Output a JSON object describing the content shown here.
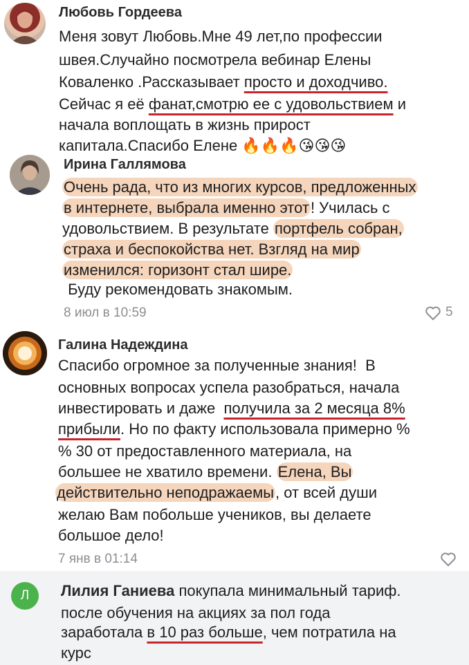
{
  "comments": [
    {
      "author": "Любовь Гордеева",
      "lines": [
        "Меня зовут Любовь.Мне 49 лет,по профессии",
        "швея.Случайно посмотрела вебинар Елены",
        {
          "pre": "Коваленко .Рассказывает ",
          "mark": "просто и доходчиво.",
          "post": ""
        },
        {
          "pre": "Сейчас я её ",
          "mark": "фанат,смотрю ее с удовольствием",
          "post": " и"
        },
        "начала воплощать в жизнь прирост",
        "капитала.Спасибо Елене"
      ],
      "emoji": [
        "🔥",
        "🔥",
        "🔥",
        "😘",
        "😘",
        "😘"
      ]
    },
    {
      "author": "Ирина Галлямова",
      "lines": [
        {
          "mark": "Очень рада, что из многих курсов, предложенных"
        },
        {
          "mark": "в интернете, выбрала именно этот",
          "post": "! Училась с"
        },
        {
          "pre": "удовольствием. В результате ",
          "mark": "портфель собран,"
        },
        {
          "mark": "страха и беспокойства нет. Взгляд на мир"
        },
        {
          "mark": "изменился: горизонт стал шире."
        },
        " Буду рекомендовать знакомым."
      ],
      "date": "8 июл в 10:59",
      "likes": "5"
    },
    {
      "author": "Галина Надеждина",
      "lines": [
        "Спасибо огромное за полученные знания!  В",
        "основных вопросах успела разобраться, начала",
        {
          "pre": "инвестировать и даже  ",
          "mark": "получила за 2 месяца 8%"
        },
        {
          "mark": "прибыли",
          "post": ". Но по факту использовала примерно %"
        },
        "% 30 от предоставленного материала, на",
        {
          "pre": "большее не хватило времени. ",
          "mark": "Елена, Вы"
        },
        {
          "mark": "действительно неподражаемы",
          "post": ", от всей души"
        },
        "желаю Вам побольше учеников, вы делаете",
        "большое дело!"
      ],
      "date": "7 янв в 01:14"
    },
    {
      "author": "Лилия Ганиева",
      "avatar_letter": "Л",
      "first_line": "покупала минимальный тариф.",
      "lines": [
        "после обучения на акциях за пол года",
        {
          "pre": "заработала ",
          "mark": "в 10 раз больше",
          "post": ", чем потратила на"
        },
        "курс"
      ]
    }
  ],
  "colors": {
    "highlight": "#ecb284",
    "underline": "#c8242b",
    "avatar_green": "#4bb34b",
    "reply_bg": "#f2f3f5"
  },
  "icons": [
    "heart-icon",
    "fire-emoji",
    "kiss-emoji"
  ]
}
